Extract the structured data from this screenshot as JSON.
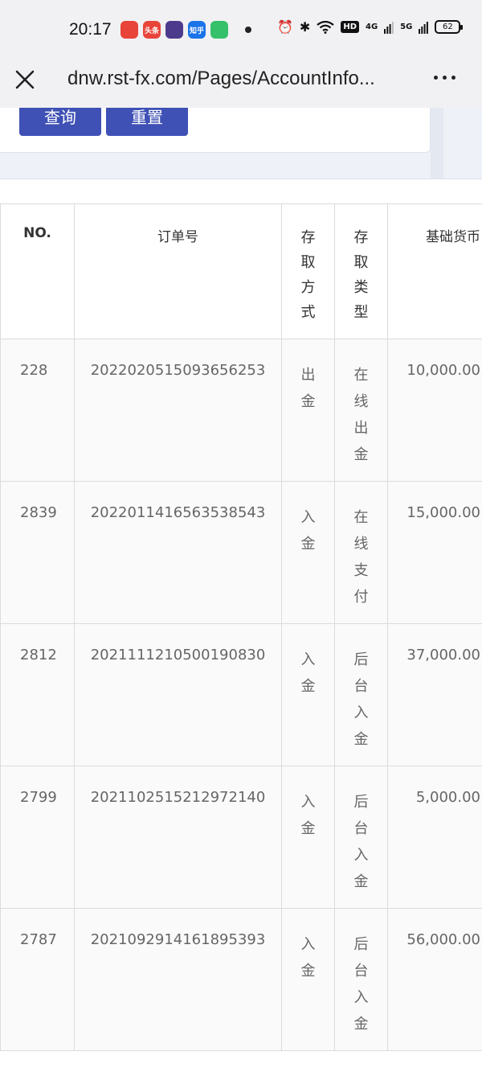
{
  "status_bar": {
    "time": "20:17",
    "apps": [
      {
        "name": "app-weibo-icon",
        "label": "",
        "color": "#e8443a"
      },
      {
        "name": "app-toutiao-icon",
        "label": "头条",
        "color": "#e8443a"
      },
      {
        "name": "app-purple-icon",
        "label": "",
        "color": "#4c3a8c"
      },
      {
        "name": "app-zhihu-icon",
        "label": "知乎",
        "color": "#1a73e8"
      },
      {
        "name": "app-green-icon",
        "label": "",
        "color": "#35c06a"
      }
    ],
    "hd_label": "HD",
    "signal_1": "4G",
    "signal_2": "5G",
    "battery": "62"
  },
  "browser": {
    "url": "dnw.rst-fx.com/Pages/AccountInfo..."
  },
  "search": {
    "query_label": "查询",
    "reset_label": "重置"
  },
  "table": {
    "headers": {
      "no": "NO.",
      "order": "订单号",
      "mode": "存取方式",
      "type": "存取类型",
      "amount": "基础货币"
    },
    "rows": [
      {
        "no": "228",
        "order": "2022020515093656253",
        "mode": "出金",
        "type": "在线出金",
        "amount": "10,000.00"
      },
      {
        "no": "2839",
        "order": "2022011416563538543",
        "mode": "入金",
        "type": "在线支付",
        "amount": "15,000.00"
      },
      {
        "no": "2812",
        "order": "2021111210500190830",
        "mode": "入金",
        "type": "后台入金",
        "amount": "37,000.00"
      },
      {
        "no": "2799",
        "order": "2021102515212972140",
        "mode": "入金",
        "type": "后台入金",
        "amount": "5,000.00"
      },
      {
        "no": "2787",
        "order": "2021092914161895393",
        "mode": "入金",
        "type": "后台入金",
        "amount": "56,000.00"
      }
    ]
  },
  "colors": {
    "primary_button": "#3f51b5",
    "page_bg": "#eef1f7"
  }
}
